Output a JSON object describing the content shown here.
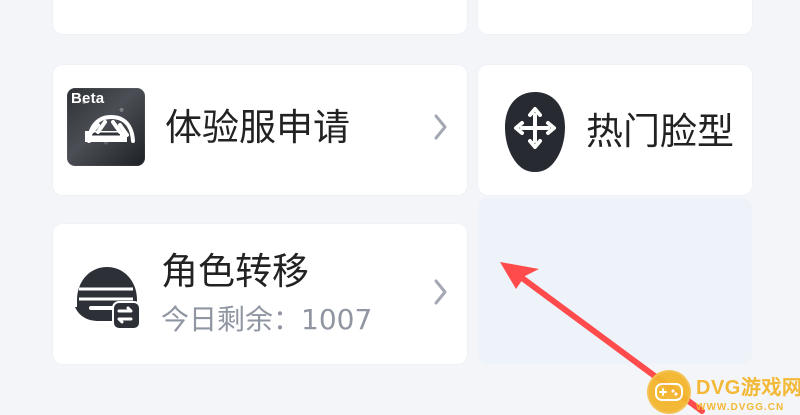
{
  "cards": {
    "beta_server": {
      "badge": "Beta",
      "label": "体验服申请",
      "icon": "beta-helmet-icon"
    },
    "popular_face": {
      "label": "热门脸型",
      "icon": "face-move-icon"
    },
    "role_transfer": {
      "label": "角色转移",
      "subtitle": "今日剩余：1007",
      "icon": "helmet-transfer-icon"
    }
  },
  "annotation": {
    "arrow_color": "#ff4b4b"
  },
  "watermark": {
    "title": "DVG游戏网",
    "subtitle": "WWW.DVGG.CN",
    "color": "#f3b62c"
  }
}
